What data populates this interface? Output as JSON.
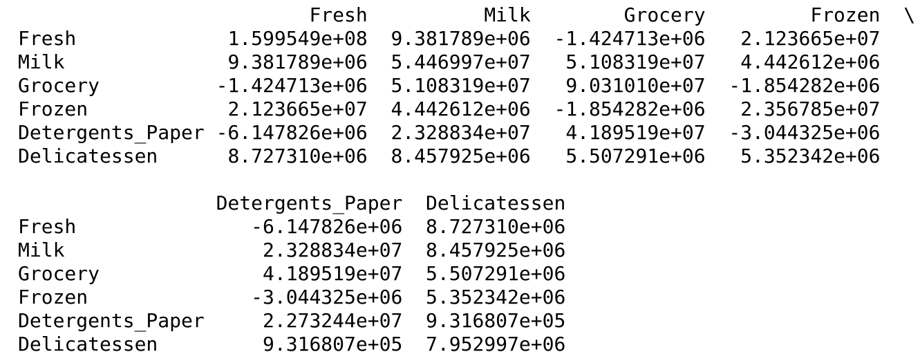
{
  "block1": {
    "header": [
      "Fresh",
      "Milk",
      "Grocery",
      "Frozen"
    ],
    "continuation": "\\",
    "rows": [
      {
        "label": "Fresh",
        "values": [
          "1.599549e+08",
          "9.381789e+06",
          "-1.424713e+06",
          "2.123665e+07"
        ]
      },
      {
        "label": "Milk",
        "values": [
          "9.381789e+06",
          "5.446997e+07",
          "5.108319e+07",
          "4.442612e+06"
        ]
      },
      {
        "label": "Grocery",
        "values": [
          "-1.424713e+06",
          "5.108319e+07",
          "9.031010e+07",
          "-1.854282e+06"
        ]
      },
      {
        "label": "Frozen",
        "values": [
          "2.123665e+07",
          "4.442612e+06",
          "-1.854282e+06",
          "2.356785e+07"
        ]
      },
      {
        "label": "Detergents_Paper",
        "values": [
          "-6.147826e+06",
          "2.328834e+07",
          "4.189519e+07",
          "-3.044325e+06"
        ]
      },
      {
        "label": "Delicatessen",
        "values": [
          "8.727310e+06",
          "8.457925e+06",
          "5.507291e+06",
          "5.352342e+06"
        ]
      }
    ]
  },
  "block2": {
    "header": [
      "Detergents_Paper",
      "Delicatessen"
    ],
    "rows": [
      {
        "label": "Fresh",
        "values": [
          "-6.147826e+06",
          "8.727310e+06"
        ]
      },
      {
        "label": "Milk",
        "values": [
          "2.328834e+07",
          "8.457925e+06"
        ]
      },
      {
        "label": "Grocery",
        "values": [
          "4.189519e+07",
          "5.507291e+06"
        ]
      },
      {
        "label": "Frozen",
        "values": [
          "-3.044325e+06",
          "5.352342e+06"
        ]
      },
      {
        "label": "Detergents_Paper",
        "values": [
          "2.273244e+07",
          "9.316807e+05"
        ]
      },
      {
        "label": "Delicatessen",
        "values": [
          "9.316807e+05",
          "7.952997e+06"
        ]
      }
    ]
  }
}
